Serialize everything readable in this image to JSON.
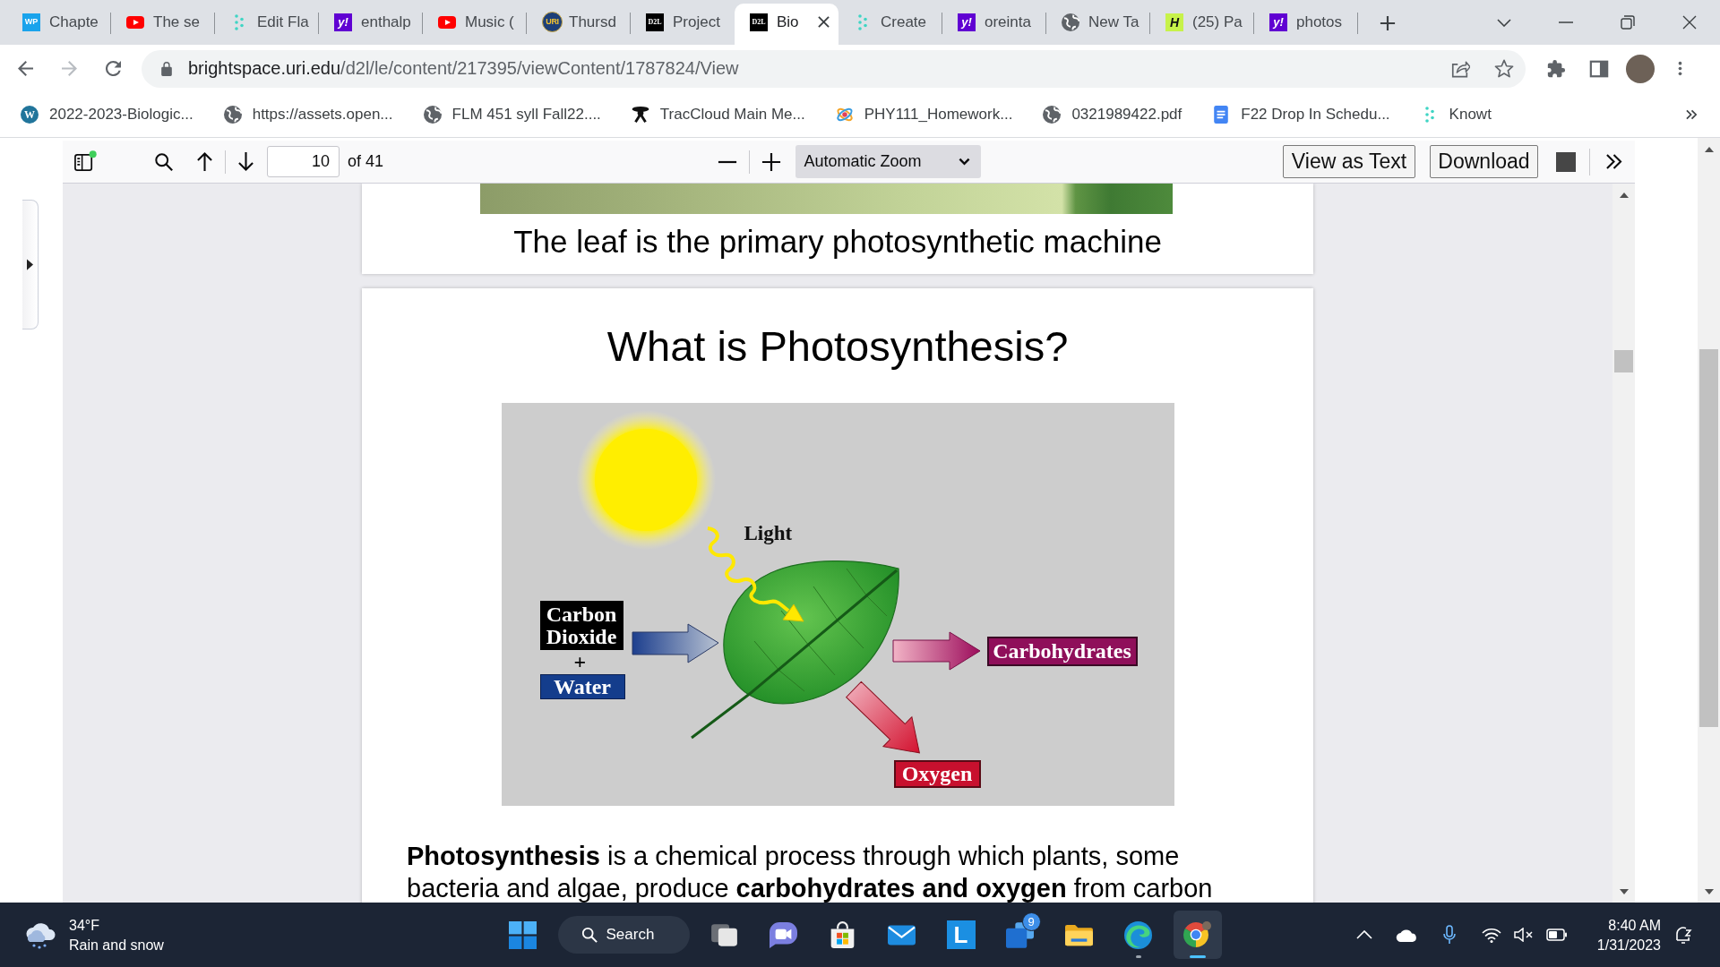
{
  "browser": {
    "tabs": [
      {
        "title": "Chapte",
        "kind": "wp",
        "icon_text": "WP",
        "selected": false
      },
      {
        "title": "The se",
        "kind": "youtube",
        "selected": false
      },
      {
        "title": "Edit Fla",
        "kind": "knowt",
        "selected": false
      },
      {
        "title": "enthalp",
        "kind": "yahoo",
        "icon_text": "y!",
        "selected": false
      },
      {
        "title": "Music (",
        "kind": "youtube",
        "selected": false
      },
      {
        "title": "Thursd",
        "kind": "uri",
        "icon_text": "URI",
        "selected": false
      },
      {
        "title": "Project",
        "kind": "d2l",
        "icon_text": "D2L",
        "selected": false
      },
      {
        "title": "Bio",
        "kind": "d2l",
        "icon_text": "D2L",
        "selected": true
      },
      {
        "title": "Create",
        "kind": "knowt",
        "selected": false
      },
      {
        "title": "oreinta",
        "kind": "yahoo",
        "icon_text": "y!",
        "selected": false
      },
      {
        "title": "New Ta",
        "kind": "globe",
        "selected": false
      },
      {
        "title": "(25) Pa",
        "kind": "h",
        "icon_text": "H",
        "selected": false
      },
      {
        "title": "photos",
        "kind": "yahoo",
        "icon_text": "y!",
        "selected": false
      }
    ],
    "nav": [
      {
        "kind": "back",
        "disabled": false
      },
      {
        "kind": "forward",
        "disabled": true
      },
      {
        "kind": "reload",
        "disabled": false
      }
    ],
    "url": {
      "host": "brightspace.uri.edu",
      "path": "/d2l/le/content/217395/viewContent/1787824/View"
    },
    "bookmarks": [
      {
        "title": "2022-2023-Biologic...",
        "kind": "wordpress",
        "icon_text": "W"
      },
      {
        "title": "https://assets.open...",
        "kind": "globe"
      },
      {
        "title": "FLM 451 syll Fall22....",
        "kind": "globe"
      },
      {
        "title": "TracCloud Main Me...",
        "kind": "figure"
      },
      {
        "title": "PHY111_Homework...",
        "kind": "atom"
      },
      {
        "title": "0321989422.pdf",
        "kind": "globe"
      },
      {
        "title": "F22 Drop In Schedu...",
        "kind": "doc"
      },
      {
        "title": "Knowt",
        "kind": "dots"
      }
    ]
  },
  "pdf_viewer": {
    "page": "10",
    "page_total": "of 41",
    "zoom": "Automatic Zoom",
    "buttons": [
      "View as Text",
      "Download"
    ]
  },
  "document": {
    "previous_page": {
      "caption": "The leaf is the primary photosynthetic machine"
    },
    "current_page": {
      "title": "What is Photosynthesis?",
      "diagram": {
        "light_label": "Light",
        "inputs": [
          {
            "label": "Carbon Dioxide",
            "color": "#000000"
          },
          {
            "label": "Water",
            "color": "#143d8c"
          }
        ],
        "plus": "+",
        "outputs": [
          {
            "label": "Carbohydrates",
            "color": "#8f0f5a"
          },
          {
            "label": "Oxygen",
            "color": "#c8102e"
          }
        ]
      },
      "paragraph": "**Photosynthesis** is a chemical process through which plants, some bacteria and algae, produce **carbohydrates and oxygen** from carbon"
    }
  },
  "taskbar": {
    "weather": {
      "temperature": "34°F",
      "condition": "Rain and snow"
    },
    "search": {
      "label": "Search"
    },
    "apps": [
      {
        "kind": "chat",
        "running": false,
        "selected": false
      },
      {
        "kind": "store",
        "running": false,
        "selected": false
      },
      {
        "kind": "mail",
        "running": false,
        "selected": false
      },
      {
        "kind": "letter",
        "icon_text": "L",
        "running": false,
        "selected": false
      },
      {
        "kind": "cards",
        "badge": "9",
        "running": false,
        "selected": false
      },
      {
        "kind": "folder",
        "running": false,
        "selected": false
      },
      {
        "kind": "swirl",
        "running": true,
        "selected": false
      },
      {
        "kind": "round",
        "running": true,
        "selected": true
      }
    ],
    "tray": {
      "volume_muted": true
    },
    "clock": {
      "time": "8:40 AM",
      "date": "1/31/2023"
    }
  }
}
